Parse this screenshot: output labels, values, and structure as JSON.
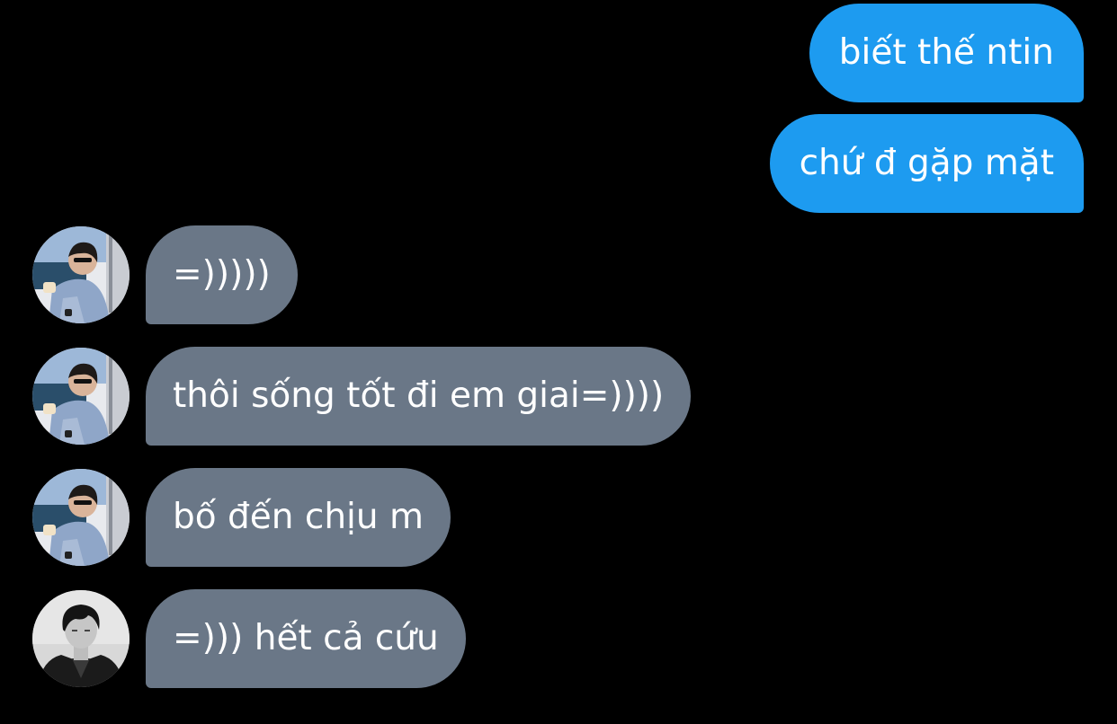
{
  "messages": {
    "sent": [
      {
        "text": "biết thế ntin"
      },
      {
        "text": "chứ đ gặp mặt"
      }
    ],
    "received": [
      {
        "text": "=)))))"
      },
      {
        "text": "thôi sống tốt đi em giai=))))"
      },
      {
        "text": "bố đến chịu m"
      },
      {
        "text": "=))) hết cả cứu"
      }
    ]
  },
  "colors": {
    "background": "#000000",
    "sent_bubble": "#1d9bf0",
    "received_bubble": "#6a7787",
    "text": "#ffffff"
  }
}
